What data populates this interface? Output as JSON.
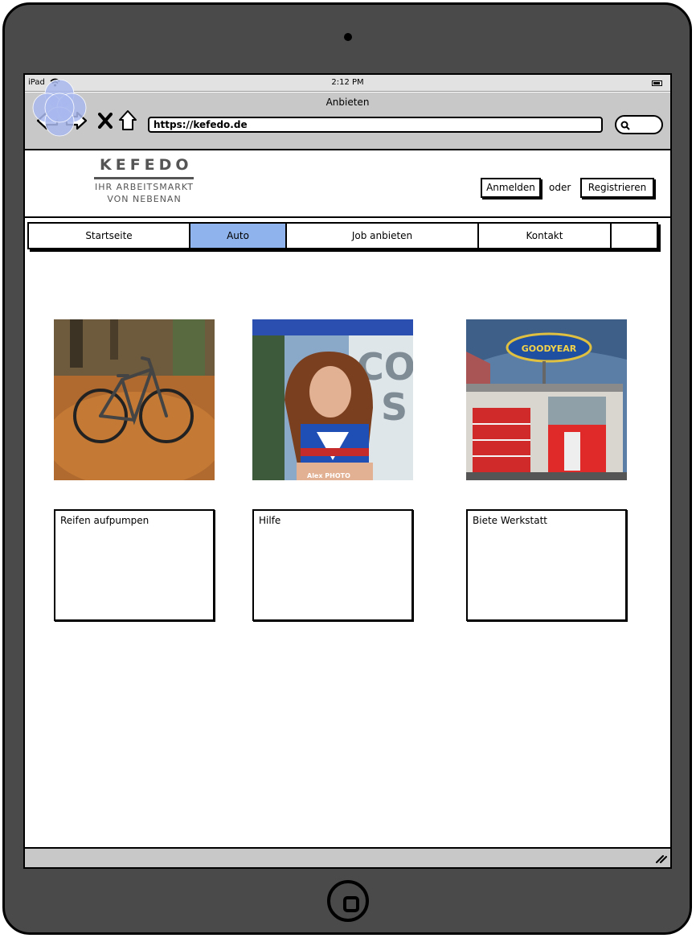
{
  "status_bar": {
    "device": "iPad",
    "time": "2:12 PM"
  },
  "browser": {
    "title": "Anbieten",
    "url": "https://kefedo.de"
  },
  "brand": {
    "name": "KEFEDO",
    "tagline_line1": "IHR ARBEITSMARKT",
    "tagline_line2": "VON NEBENAN"
  },
  "auth": {
    "login": "Anmelden",
    "separator": "oder",
    "register": "Registrieren"
  },
  "nav": {
    "tabs": [
      {
        "label": "Startseite"
      },
      {
        "label": "Auto",
        "active": true
      },
      {
        "label": "Job anbieten"
      },
      {
        "label": "Kontakt"
      },
      {
        "label": ""
      }
    ]
  },
  "listings": [
    {
      "title": "Reifen aufpumpen",
      "image": "mountain-bike-on-autumn-leaves"
    },
    {
      "title": "Hilfe",
      "image": "woman-in-sport-top",
      "watermark": "Alex PHOTO"
    },
    {
      "title": "Biete Werkstatt",
      "image": "garage-with-red-doors",
      "sign": "GOODYEAR"
    }
  ],
  "colors": {
    "active_tab": "#8fb3ec",
    "chrome": "#c8c8c8",
    "device": "#4a4a4a",
    "logo": "#a9b9ee"
  },
  "icons": [
    "wifi-icon",
    "battery-icon",
    "back-arrow-icon",
    "forward-arrow-icon",
    "close-icon",
    "home-icon",
    "search-icon",
    "resize-grip-icon"
  ]
}
